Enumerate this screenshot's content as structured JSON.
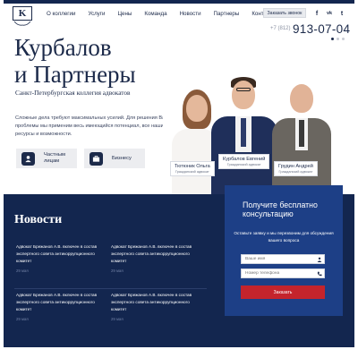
{
  "header": {
    "logo_letter": "K",
    "nav": [
      "О коллегии",
      "Услуги",
      "Цены",
      "Команда",
      "Новости",
      "Партнеры",
      "Контакты"
    ],
    "callback_label": "Заказать звонок",
    "social": [
      {
        "icon": "facebook-icon",
        "glyph": "f"
      },
      {
        "icon": "vk-icon",
        "glyph": "vk"
      },
      {
        "icon": "twitter-icon",
        "glyph": "t"
      }
    ],
    "phone_prefix": "+7 (812)",
    "phone_number": "913-07-04"
  },
  "hero": {
    "title_line1": "Курбалов",
    "title_line2": "и Партнеры",
    "subtitle": "Санкт-Петербургская коллегия адвокатов",
    "text": "Сложные дела требуют максимальных усилий. Для решения Вашей проблемы мы применим весь имеющийся потенциал, все наши ресурсы и возможности.",
    "buttons": [
      {
        "label": "Частным лицам",
        "icon": "person-icon"
      },
      {
        "label": "Бизнесу",
        "icon": "briefcase-icon"
      }
    ]
  },
  "team": [
    {
      "name": "Тютюник Ольга",
      "role": "Гражданский адвокат"
    },
    {
      "name": "Курбалов Евгений",
      "role": "Гражданский адвокат"
    },
    {
      "name": "Грудин Андрей",
      "role": "Гражданский адвокат"
    }
  ],
  "news": {
    "title": "Новости",
    "items": [
      {
        "text": "Адвокат Брежанов А.В. включен в состав экспертного совета антикоррупционного комитет",
        "date": "29 мая"
      },
      {
        "text": "Адвокат Брежанов А.В. включен в состав экспертного совета антикоррупционного комитет",
        "date": "29 мая"
      },
      {
        "text": "Адвокат Брежанов А.В. включен в состав экспертного совета антикоррупционного комитет",
        "date": "29 мая"
      },
      {
        "text": "Адвокат Брежанов А.В. включен в состав экспертного совета антикоррупционного комитет",
        "date": "29 мая"
      }
    ]
  },
  "consult": {
    "title": "Получите бесплатно консультацию",
    "text": "Оставьте заявку и мы перезвоним для обсуждения вашего вопроса",
    "name_placeholder": "Ваше имя",
    "phone_placeholder": "Номер телефона",
    "submit_label": "Заказать"
  },
  "colors": {
    "navy": "#13264f",
    "form_blue": "#1d3f86",
    "accent_red": "#c4242c"
  }
}
